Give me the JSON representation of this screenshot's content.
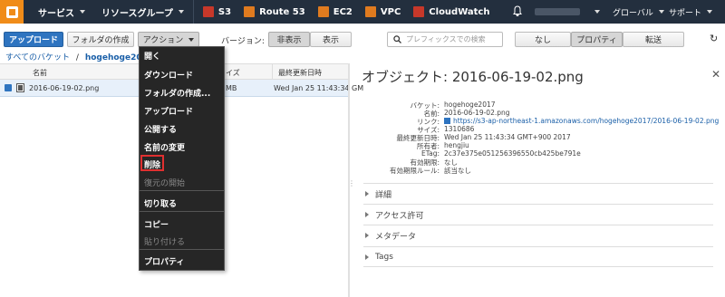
{
  "topnav": {
    "services": "サービス",
    "resource_groups": "リソースグループ",
    "pinned": [
      {
        "label": "S3",
        "color": "#c7382a"
      },
      {
        "label": "Route 53",
        "color": "#e07b1f"
      },
      {
        "label": "EC2",
        "color": "#e07b1f"
      },
      {
        "label": "VPC",
        "color": "#e07b1f"
      },
      {
        "label": "CloudWatch",
        "color": "#c7382a"
      }
    ],
    "region": "グローバル",
    "support": "サポート"
  },
  "toolbar": {
    "upload": "アップロード",
    "create_folder": "フォルダの作成",
    "actions": "アクション",
    "version_label": "バージョン:",
    "hide": "非表示",
    "show": "表示",
    "search_placeholder": "プレフィックスでの検索",
    "view_none": "なし",
    "view_properties": "プロパティ",
    "view_transfer": "転送"
  },
  "breadcrumb": {
    "all_buckets": "すべてのバケット",
    "separator": "/",
    "bucket": "hogehoge2017"
  },
  "table": {
    "headers": {
      "name": "名前",
      "size": "イズ",
      "modified": "最終更新日時"
    },
    "rows": [
      {
        "name": "2016-06-19-02.png",
        "size": "MB",
        "modified": "Wed Jan 25 11:43:34 GM"
      }
    ]
  },
  "menu": {
    "items": [
      {
        "label": "開く",
        "enabled": true
      },
      {
        "label": "ダウンロード",
        "enabled": true
      },
      {
        "label": "フォルダの作成...",
        "enabled": true
      },
      {
        "label": "アップロード",
        "enabled": true
      },
      {
        "label": "公開する",
        "enabled": true
      },
      {
        "label": "名前の変更",
        "enabled": true
      },
      {
        "label": "削除",
        "enabled": true,
        "highlighted": true
      },
      {
        "label": "復元の開始",
        "enabled": false
      },
      {
        "label": "切り取る",
        "enabled": true
      },
      {
        "label": "コピー",
        "enabled": true
      },
      {
        "label": "貼り付ける",
        "enabled": false
      },
      {
        "label": "プロパティ",
        "enabled": true
      }
    ]
  },
  "detail": {
    "title": "オブジェクト: 2016-06-19-02.png",
    "properties": [
      {
        "key": "バケット:",
        "value": "hogehoge2017"
      },
      {
        "key": "名前:",
        "value": "2016-06-19-02.png"
      },
      {
        "key": "リンク:",
        "value": "https://s3-ap-northeast-1.amazonaws.com/hogehoge2017/2016-06-19-02.png"
      },
      {
        "key": "サイズ:",
        "value": "1310686"
      },
      {
        "key": "最終更新日時:",
        "value": "Wed Jan 25 11:43:34 GMT+900 2017"
      },
      {
        "key": "所有者:",
        "value": "hengjiu"
      },
      {
        "key": "ETag:",
        "value": "2c37e375e051256396550cb425be791e"
      },
      {
        "key": "有効期限:",
        "value": "なし"
      },
      {
        "key": "有効期限ルール:",
        "value": "該当なし"
      }
    ],
    "sections": [
      "詳細",
      "アクセス許可",
      "メタデータ",
      "Tags"
    ]
  }
}
